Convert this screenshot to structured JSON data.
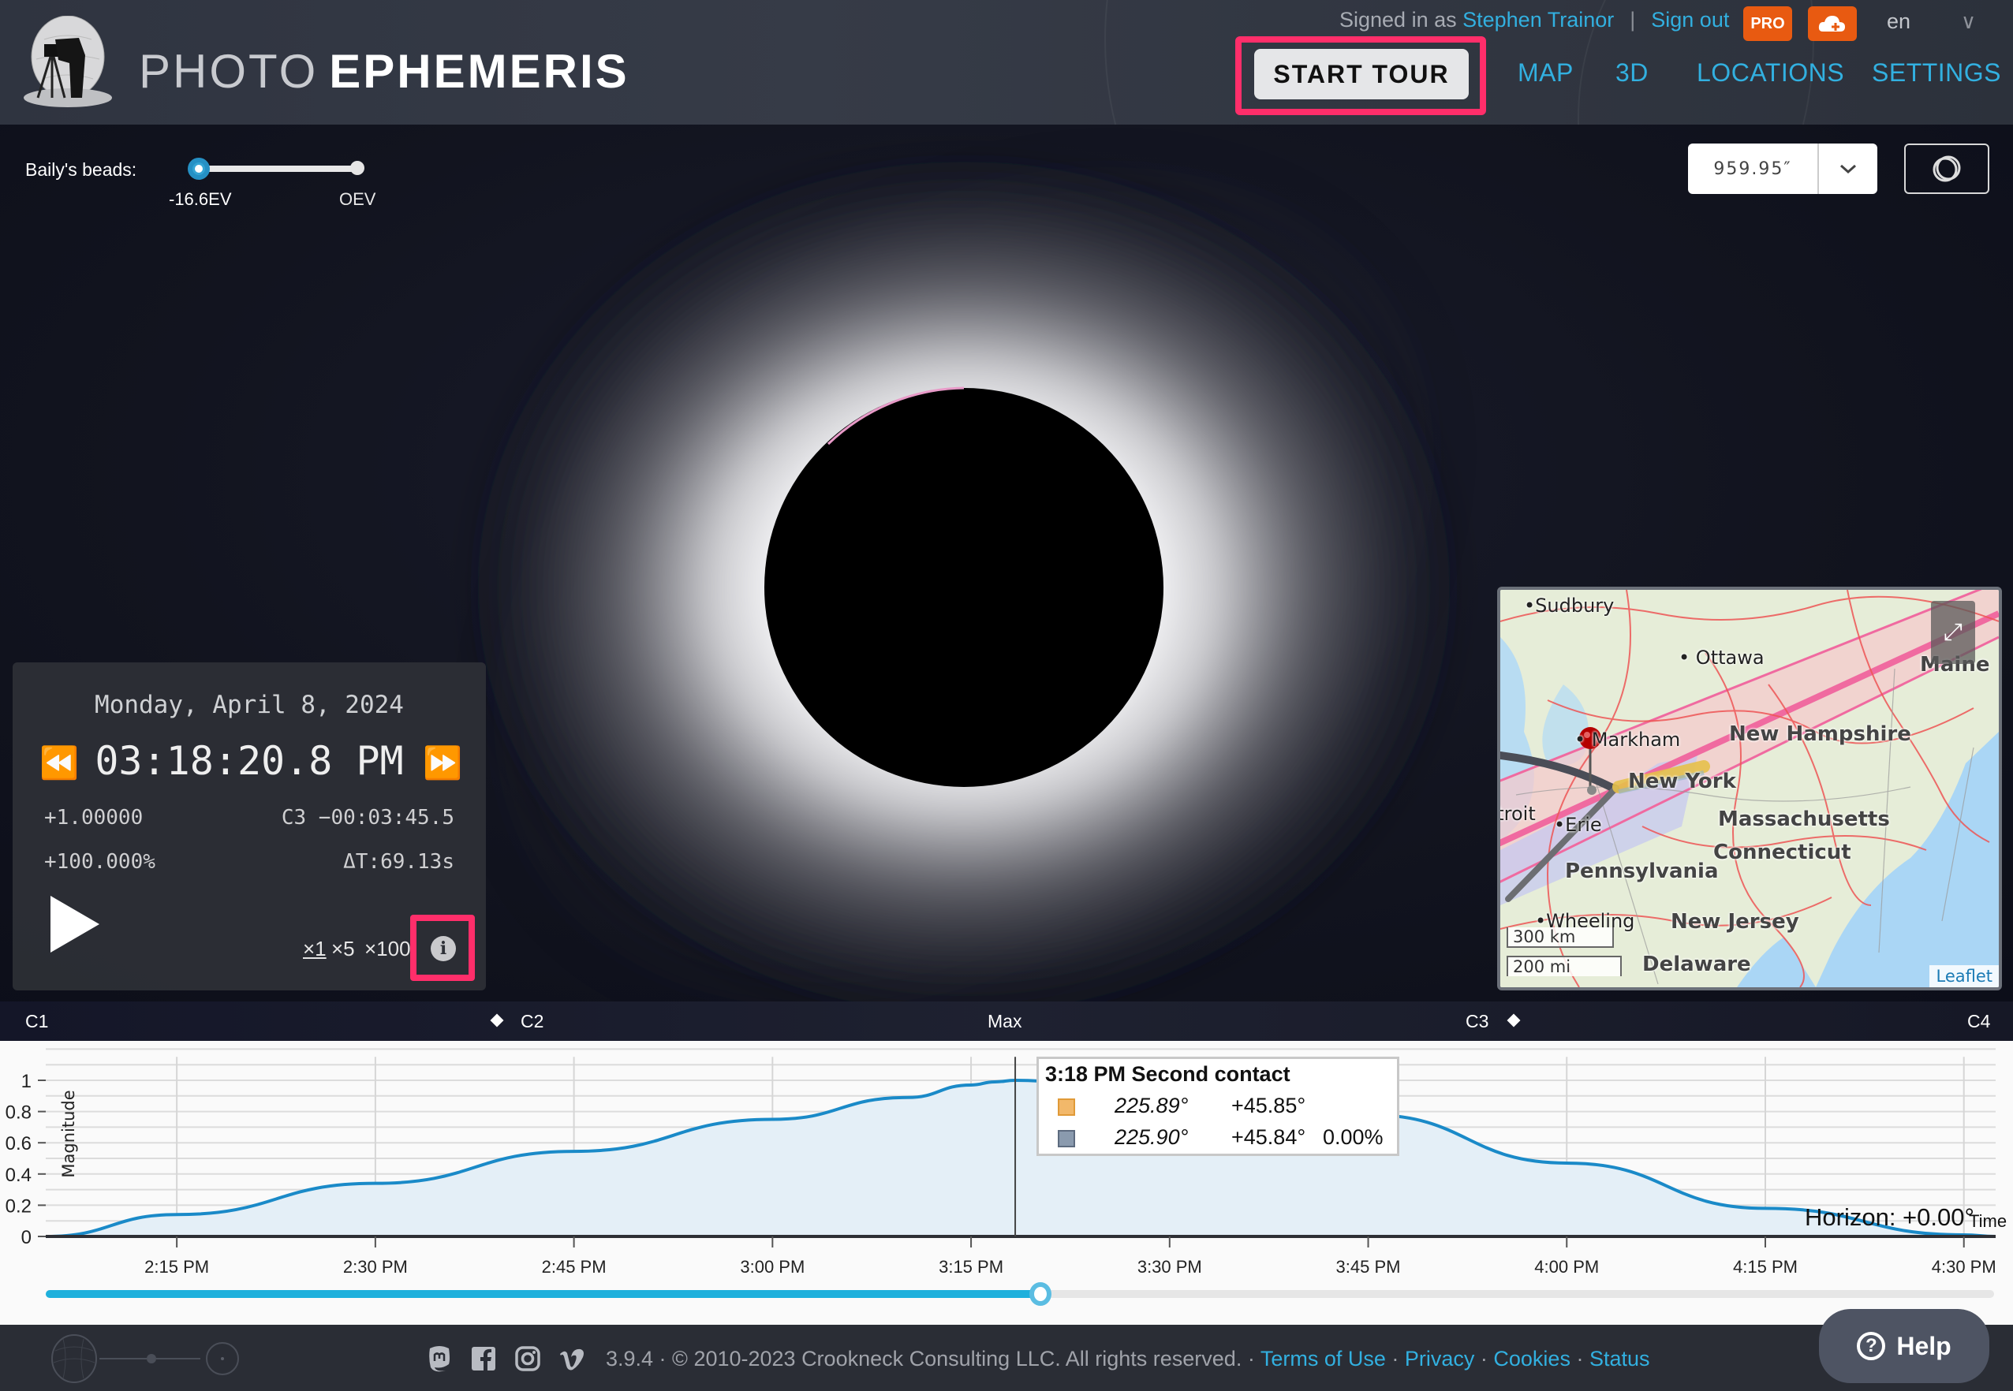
{
  "header": {
    "logo_light": "PHOTO",
    "logo_bold": "EPHEMERIS",
    "signed_in_prefix": "Signed in as",
    "user_name": "Stephen Trainor",
    "separator": "|",
    "sign_out": "Sign out",
    "pro_badge": "PRO",
    "language": "en",
    "start_tour": "START TOUR",
    "nav": [
      "MAP",
      "3D",
      "LOCATIONS",
      "SETTINGS"
    ]
  },
  "bailys_beads": {
    "label": "Baily's beads:",
    "min_label": "-16.6EV",
    "max_label": "OEV",
    "value_fraction": 0.0
  },
  "moon_diameter": {
    "value": "959.95″"
  },
  "time_panel": {
    "date": "Monday, April 8, 2024",
    "time": "03:18:20.8 PM",
    "magnitude": "+1.00000",
    "contact_countdown": "C3 −00:03:45.5",
    "obscuration": "+100.000%",
    "delta_t": "ΔT:69.13s",
    "speeds": [
      "×1",
      "×5",
      "×100"
    ],
    "active_speed": "×1"
  },
  "map": {
    "labels": [
      "New Hampshire",
      "New York",
      "Massachusetts",
      "Connecticut",
      "Pennsylvania",
      "New Jersey",
      "Delaware",
      "Maine"
    ],
    "cities": [
      "Sudbury",
      "Ottawa",
      "Markham",
      "Erie",
      "Wheeling",
      "Detroit"
    ],
    "scale_km": "300 km",
    "scale_mi": "200 mi",
    "attribution": "Leaflet"
  },
  "contacts": {
    "c1": "C1",
    "c2": "C2",
    "max": "Max",
    "c3": "C3",
    "c4": "C4"
  },
  "tooltip": {
    "title": "3:18 PM Second contact",
    "sun": {
      "azimuth": "225.89°",
      "altitude": "+45.85°",
      "color": "#f2b86a"
    },
    "moon": {
      "azimuth": "225.90°",
      "altitude": "+45.84°",
      "illumination": "0.00%",
      "color": "#8a9aae"
    }
  },
  "timeline": {
    "progress_fraction": 0.5105
  },
  "footer": {
    "copyright": "3.9.4 · © 2010-2023 Crookneck Consulting LLC. All rights reserved. ·",
    "links": [
      "Terms of Use",
      "Privacy",
      "Cookies",
      "Status"
    ],
    "help": "Help"
  },
  "chart_data": {
    "type": "area",
    "title": "",
    "ylabel": "Magnitude",
    "xlabel": "Time",
    "ylim": [
      0,
      1.1
    ],
    "yticks": [
      0,
      0.2,
      0.4,
      0.6,
      0.8,
      1
    ],
    "ytick_labels": [
      "0",
      "0.2",
      "0.4",
      "0.6",
      "0.8",
      "1"
    ],
    "x_range_minutes": [
      2.1,
      4.52
    ],
    "xtick_labels": [
      "2:15 PM",
      "2:30 PM",
      "2:45 PM",
      "3:00 PM",
      "3:15 PM",
      "3:30 PM",
      "3:45 PM",
      "4:00 PM",
      "4:15 PM",
      "4:30 PM"
    ],
    "xtick_hours": [
      14.25,
      14.5,
      14.75,
      15.0,
      15.25,
      15.5,
      15.75,
      16.0,
      16.25,
      16.5
    ],
    "x_hours": [
      14.085,
      14.25,
      14.5,
      14.75,
      15.0,
      15.17,
      15.25,
      15.28,
      15.3056,
      15.37,
      15.5,
      15.75,
      16.0,
      16.25,
      16.5,
      16.54
    ],
    "magnitude": [
      0.0,
      0.14,
      0.34,
      0.545,
      0.75,
      0.89,
      0.97,
      0.99,
      1.0,
      0.99,
      0.97,
      0.78,
      0.47,
      0.18,
      0.01,
      0.0
    ],
    "cursor_hour": 15.3056,
    "annotation": "Horizon: +0.00°",
    "grid": true,
    "series_color": "#1a8ac8",
    "fill_color": "#e4eff7"
  }
}
